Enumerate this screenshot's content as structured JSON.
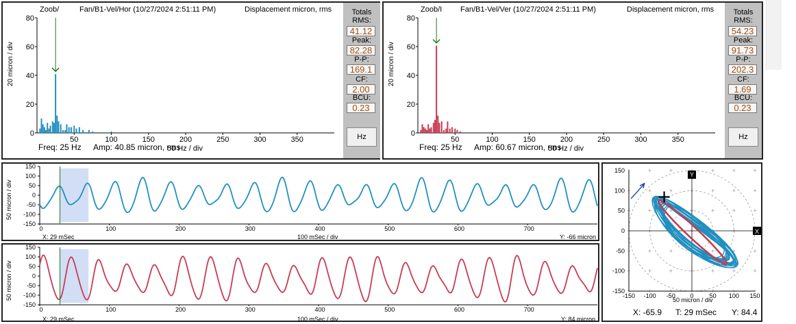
{
  "spectrum_hor": {
    "label_left": "Zoob/",
    "title": "Fan/B1-Vel/Hor (10/27/2024 2:51:11 PM)",
    "units": "Displacement micron, rms",
    "y_axis_title": "20 micron / div",
    "y_ticks": [
      "80",
      "60",
      "40",
      "20",
      "0"
    ],
    "x_ticks": [
      "50",
      "100",
      "150",
      "200",
      "250",
      "300",
      "350"
    ],
    "freq": "Freq: 25 Hz",
    "amp": "Amp: 40.85 micron, rms",
    "x_div": "50 Hz / div",
    "color": "#1f8fc0",
    "totals": {
      "header": "Totals",
      "rms_label": "RMS:",
      "rms": "41.12",
      "peak_label": "Peak:",
      "peak": "82.28",
      "pp_label": "P-P:",
      "pp": "169.1",
      "cf_label": "CF:",
      "cf": "2.00",
      "bcu_label": "BCU:",
      "bcu": "0.23",
      "hz_button": "Hz"
    }
  },
  "spectrum_ver": {
    "label_left": "Zoob/I",
    "title": "Fan/B1-Vel/Ver (10/27/2024 2:51:11 PM)",
    "units": "Displacement micron, rms",
    "y_axis_title": "20 micron / div",
    "y_ticks": [
      "80",
      "60",
      "40",
      "20",
      "0"
    ],
    "x_ticks": [
      "50",
      "100",
      "150",
      "200",
      "250",
      "300",
      "350"
    ],
    "freq": "Freq: 25 Hz",
    "amp": "Amp: 60.67 micron, rms",
    "x_div": "50 Hz / div",
    "color": "#c83a52",
    "totals": {
      "header": "Totals",
      "rms_label": "RMS:",
      "rms": "54.23",
      "peak_label": "Peak:",
      "peak": "91.73",
      "pp_label": "P-P:",
      "pp": "202.3",
      "cf_label": "CF:",
      "cf": "1.69",
      "bcu_label": "BCU:",
      "bcu": "0.23",
      "hz_button": "Hz"
    }
  },
  "waveform_hor": {
    "y_axis_title": "50 micron / div",
    "y_ticks": [
      "150",
      "100",
      "50",
      "0",
      "-50",
      "-100",
      "-150"
    ],
    "x_ticks": [
      "0",
      "100",
      "200",
      "300",
      "400",
      "500",
      "600",
      "700"
    ],
    "x_readout": "X: 29 mSec",
    "x_div": "100 mSec / div",
    "y_readout": "Y: -66 micron",
    "color": "#1f8fc0"
  },
  "waveform_ver": {
    "y_axis_title": "50 micron / div",
    "y_ticks": [
      "150",
      "100",
      "50",
      "0",
      "-50",
      "-100",
      "-150"
    ],
    "x_ticks": [
      "0",
      "100",
      "200",
      "300",
      "400",
      "500",
      "600",
      "700"
    ],
    "x_readout": "X: 29 mSec",
    "x_div": "100 mSec / div",
    "y_readout": "Y: 84 micron",
    "color": "#c83a52"
  },
  "orbit": {
    "y_ticks": [
      "150",
      "100",
      "50",
      "0",
      "-50",
      "-100",
      "-150"
    ],
    "x_ticks": [
      "-150",
      "-100",
      "-50",
      "0",
      "50",
      "100",
      "150"
    ],
    "x_axis_label": "X",
    "y_axis_label": "Y",
    "div": "50 micron / div",
    "x_readout": "X: -65.9",
    "t_readout": "T: 29 mSec",
    "y_readout": "Y: 84.4",
    "orbit_color": "#1f8fc0",
    "filtered_color": "#c83a52"
  },
  "chart_data": [
    {
      "type": "bar",
      "title": "Fan/B1-Vel/Hor (10/27/2024 2:51:11 PM)",
      "ylabel": "20 micron / div",
      "xlabel": "50 Hz / div",
      "ylim": [
        0,
        80
      ],
      "xlim": [
        0,
        400
      ],
      "cursor_x": 25,
      "x": [
        4,
        6,
        8,
        10,
        12,
        14,
        16,
        18,
        21,
        23,
        25,
        27,
        29,
        32,
        35,
        38,
        40,
        43,
        46,
        50,
        53,
        57,
        62,
        70,
        75,
        100
      ],
      "values": [
        3,
        10,
        6,
        4,
        2,
        7,
        3,
        5,
        8,
        7,
        40.85,
        12,
        8,
        6,
        2,
        2,
        6,
        4,
        4,
        5,
        3,
        4,
        2,
        2,
        1,
        1
      ]
    },
    {
      "type": "bar",
      "title": "Fan/B1-Vel/Ver (10/27/2024 2:51:11 PM)",
      "ylabel": "20 micron / div",
      "xlabel": "50 Hz / div",
      "ylim": [
        0,
        80
      ],
      "xlim": [
        0,
        400
      ],
      "cursor_x": 25,
      "x": [
        4,
        6,
        8,
        10,
        12,
        14,
        16,
        18,
        21,
        23,
        25,
        27,
        29,
        32,
        35,
        38,
        40,
        43,
        46,
        50,
        53,
        57
      ],
      "values": [
        2,
        6,
        4,
        3,
        2,
        6,
        3,
        4,
        7,
        9,
        60.67,
        12,
        7,
        8,
        2,
        3,
        8,
        3,
        4,
        3,
        2,
        1
      ]
    },
    {
      "type": "line",
      "name": "Fan/B1-Vel/Hor waveform",
      "xlabel": "100 mSec / div",
      "ylabel": "50 micron / div",
      "xlim": [
        0,
        800
      ],
      "ylim": [
        -150,
        150
      ],
      "cursor_x": 29,
      "highlight_x": [
        29,
        70
      ],
      "y_at_cursor": -66,
      "dominant_period_ms": 40,
      "amplitude_range": [
        -95,
        80
      ]
    },
    {
      "type": "line",
      "name": "Fan/B1-Vel/Ver waveform",
      "xlabel": "100 mSec / div",
      "ylabel": "50 micron / div",
      "xlim": [
        0,
        800
      ],
      "ylim": [
        -150,
        150
      ],
      "cursor_x": 29,
      "highlight_x": [
        29,
        70
      ],
      "y_at_cursor": 84,
      "dominant_period_ms": 40,
      "amplitude_range": [
        -130,
        100
      ]
    },
    {
      "type": "scatter",
      "name": "Orbit",
      "xlabel": "50 micron / div",
      "ylabel": "50 micron / div",
      "xlim": [
        -150,
        150
      ],
      "ylim": [
        -150,
        150
      ],
      "cursor": {
        "x": -65.9,
        "y": 84.4,
        "t_ms": 29
      }
    }
  ]
}
